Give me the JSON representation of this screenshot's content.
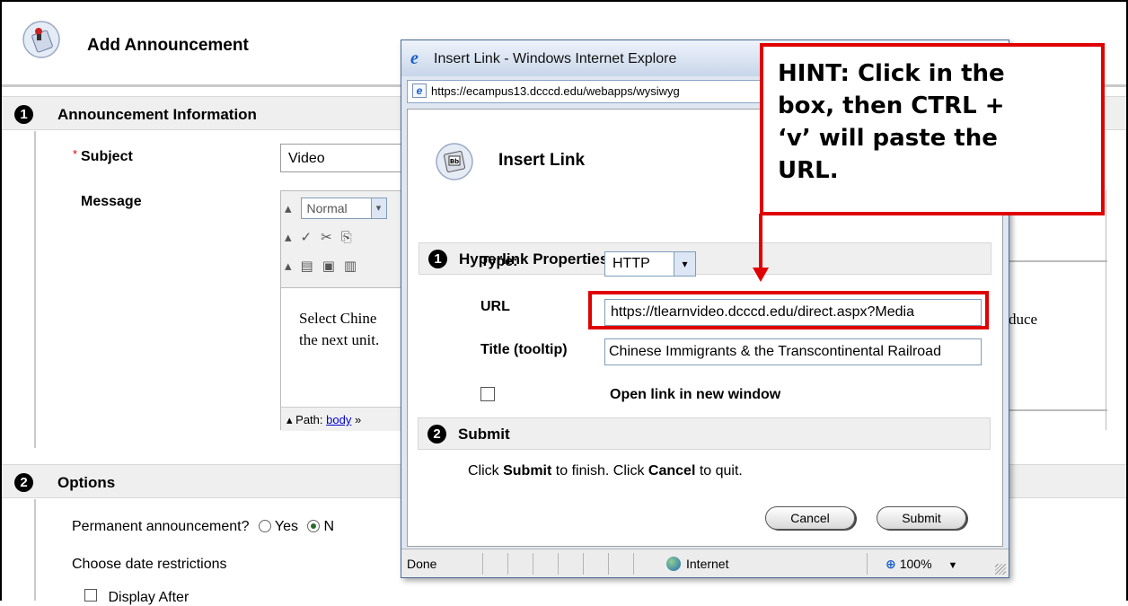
{
  "page": {
    "title": "Add Announcement",
    "section1": {
      "num": "1",
      "title": "Announcement Information"
    },
    "section2": {
      "num": "2",
      "title": "Options"
    },
    "subject_label": "Subject",
    "subject_value": "Video",
    "message_label": "Message",
    "editor": {
      "format_select": "Normal",
      "body_line1": "Select Chine",
      "body_line2": "the next unit.",
      "body_right": "duce",
      "path_label": "Path:",
      "path_link": "body",
      "path_sep": "»"
    },
    "permanent_label": "Permanent announcement?",
    "permanent_yes": "Yes",
    "permanent_no": "N",
    "date_restrictions_label": "Choose date restrictions",
    "display_after_label": "Display After"
  },
  "dialog": {
    "window_title": "Insert Link - Windows Internet Explore",
    "address": "https://ecampus13.dcccd.edu/webapps/wysiwyg",
    "header_title": "Insert Link",
    "section1": {
      "num": "1",
      "title": "Hyperlink Properties"
    },
    "type_label": "Type:",
    "type_value": "HTTP",
    "url_label": "URL",
    "url_value": "https://tlearnvideo.dcccd.edu/direct.aspx?Media",
    "title_label": "Title (tooltip)",
    "title_value": "Chinese Immigrants & the Transcontinental Railroad",
    "new_window_label": "Open link in new window",
    "section2": {
      "num": "2",
      "title": "Submit"
    },
    "help_pre": "Click ",
    "help_submit": "Submit",
    "help_mid": " to finish. Click ",
    "help_cancel": "Cancel",
    "help_post": " to quit.",
    "cancel_button": "Cancel",
    "submit_button": "Submit",
    "status": {
      "done": "Done",
      "zone": "Internet",
      "zoom": "100%"
    }
  },
  "hint": {
    "line1": "HINT: Click in the",
    "line2": "box, then CTRL +",
    "line3": "‘v’ will paste the",
    "line4": "URL."
  },
  "colors": {
    "callout": "#e00000",
    "section_bg": "#efefef",
    "dialog_frame": "#4a6a96"
  },
  "icons": [
    "announcement-icon",
    "insert-link-icon",
    "ie-icon",
    "globe-icon",
    "zoom-icon",
    "dropdown-arrow-icon",
    "radio-icon",
    "checkbox-icon"
  ]
}
